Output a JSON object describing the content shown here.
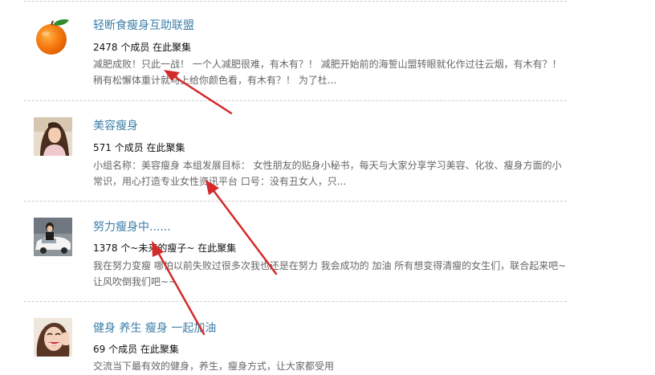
{
  "groups": [
    {
      "title": "轻断食瘦身互助联盟",
      "meta": "2478 个成员 在此聚集",
      "description": "减肥成败！只此一战！ 一个人减肥很难，有木有？！ 减肥开始前的海誓山盟转眼就化作过往云烟，有木有？！ 稍有松懈体重计就马上给你颜色看，有木有？！ 为了杜...",
      "avatar_icon": "orange-icon"
    },
    {
      "title": "美容瘦身",
      "meta": "571 个成员 在此聚集",
      "description": "小组名称：美容瘦身 本组发展目标： 女性朋友的贴身小秘书，每天与大家分享学习美容、化妆、瘦身方面的小常识，用心打造专业女性资讯平台 口号：没有丑女人，只...",
      "avatar_icon": "woman-photo-icon"
    },
    {
      "title": "努力瘦身中......",
      "meta": "1378 个~未来的瘦子~ 在此聚集",
      "description": "我在努力变瘦 哪怕以前失败过很多次我也还是在努力 我会成功的 加油 所有想变得清瘦的女生们，联合起来吧~ 让风吹倒我们吧~~",
      "avatar_icon": "car-photo-icon"
    },
    {
      "title": "健身 养生 瘦身 一起加油",
      "meta": "69 个成员 在此聚集",
      "description": "交流当下最有效的健身，养生，瘦身方式，让大家都受用",
      "avatar_icon": "smiling-woman-photo-icon"
    }
  ],
  "colors": {
    "link": "#3d7fa8",
    "text": "#111111",
    "muted": "#666666",
    "arrow": "#d42a2a",
    "divider": "#cfcfcf"
  }
}
